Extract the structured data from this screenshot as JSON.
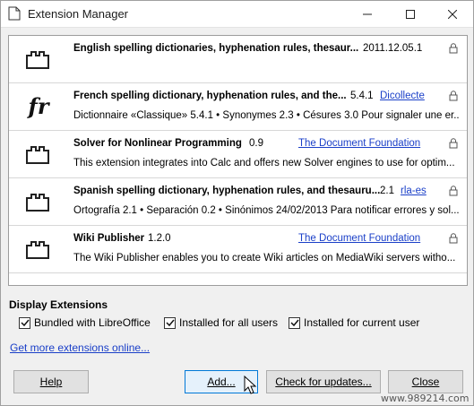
{
  "window": {
    "title": "Extension Manager",
    "icon": "document-icon",
    "controls": [
      "minimize-icon",
      "maximize-icon",
      "close-icon"
    ]
  },
  "extensions": [
    {
      "title": "English spelling dictionaries, hyphenation rules, thesaur...",
      "version": "2011.12.05.1",
      "publisher": "",
      "description": "",
      "icon": "plugin-icon"
    },
    {
      "title": "French spelling dictionary, hyphenation rules, and the...",
      "version": "5.4.1",
      "publisher": "Dicollecte",
      "description": "Dictionnaire «Classique» 5.4.1 • Synonymes 2.3 • Césures 3.0  Pour signaler une er...",
      "icon": "fr-icon",
      "icon_text": "fr"
    },
    {
      "title": "Solver for Nonlinear Programming",
      "version": "0.9",
      "publisher": "The Document Foundation",
      "description": "This extension integrates into Calc and offers new Solver engines to use for optim...",
      "icon": "plugin-icon"
    },
    {
      "title": "Spanish spelling dictionary, hyphenation rules, and thesauru...",
      "version": "2.1",
      "publisher": "rla-es",
      "description": "Ortografía 2.1 • Separación 0.2 • Sinónimos 24/02/2013  Para notificar errores y sol...",
      "icon": "plugin-icon"
    },
    {
      "title": "Wiki Publisher",
      "version": "1.2.0",
      "publisher": "The Document Foundation",
      "description": "The Wiki Publisher enables you to create Wiki articles on MediaWiki servers witho...",
      "icon": "plugin-icon"
    }
  ],
  "display": {
    "label": "Display Extensions",
    "options": [
      {
        "label": "Bundled with LibreOffice",
        "checked": true
      },
      {
        "label": "Installed for all users",
        "checked": true
      },
      {
        "label": "Installed for current user",
        "checked": true
      }
    ]
  },
  "get_more_link": "Get more extensions online...",
  "buttons": {
    "help": "Help",
    "add": "Add...",
    "updates": "Check for updates...",
    "close": "Close"
  },
  "watermark": "www.989214.com",
  "colors": {
    "link": "#1a3fc8",
    "focus_border": "#0078d7"
  }
}
